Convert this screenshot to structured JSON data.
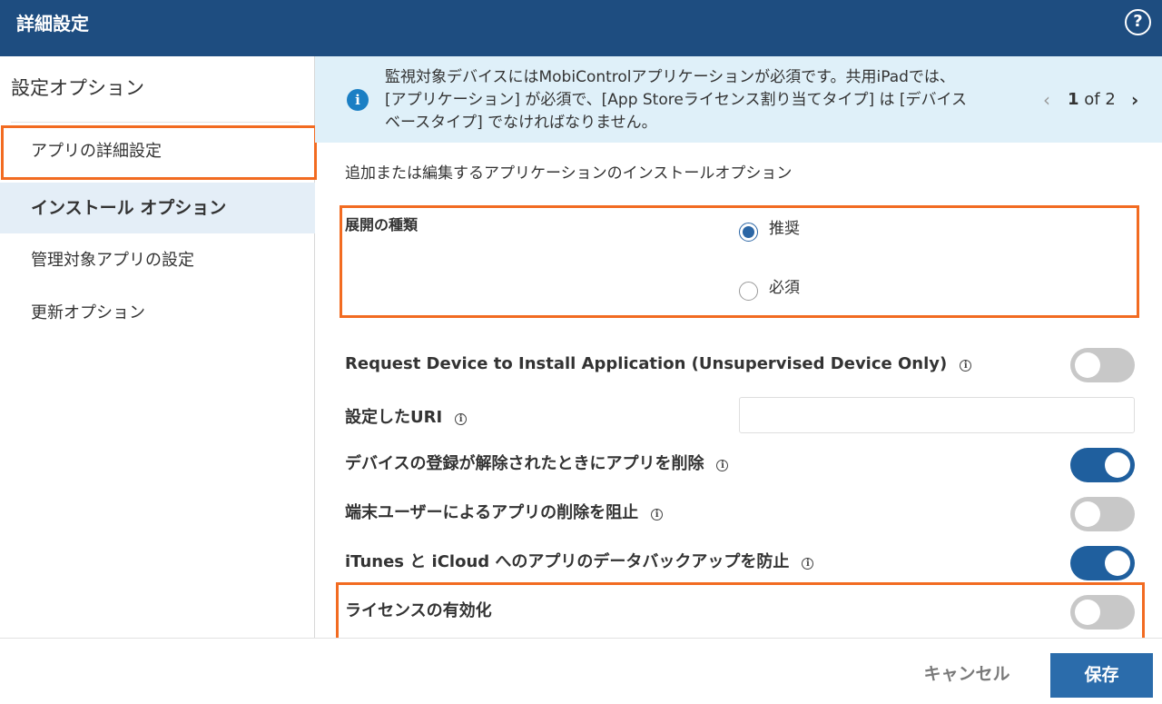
{
  "header": {
    "title": "詳細設定",
    "help_icon": "?"
  },
  "sidebar": {
    "heading": "設定オプション",
    "items": [
      {
        "label": "アプリの詳細設定",
        "active": false
      },
      {
        "label": "インストール オプション",
        "active": true
      },
      {
        "label": "管理対象アプリの設定",
        "active": false
      },
      {
        "label": "更新オプション",
        "active": false
      }
    ]
  },
  "banner": {
    "info_icon": "i",
    "lines": [
      "監視対象デバイスにはMobiControlアプリケーションが必須です。共用iPadでは、",
      "[アプリケーション] が必須で、[App Storeライセンス割り当てタイプ] は [デバイス",
      "ベースタイプ] でなければなりません。"
    ],
    "pager_current": "1",
    "pager_of": "of",
    "pager_total": "2",
    "prev_icon": "‹",
    "next_icon": "›"
  },
  "main": {
    "description": "追加または編集するアプリケーションのインストールオプション",
    "deployment": {
      "label": "展開の種類",
      "options": [
        {
          "label": "推奨",
          "checked": true
        },
        {
          "label": "必須",
          "checked": false
        }
      ]
    },
    "tip_icon": "i",
    "settings": [
      {
        "label": "Request Device to Install Application (Unsupervised Device Only)",
        "type": "toggle",
        "on": false
      },
      {
        "label": "設定したURI",
        "type": "input",
        "value": ""
      },
      {
        "label": "デバイスの登録が解除されたときにアプリを削除",
        "type": "toggle",
        "on": true
      },
      {
        "label": "端末ユーザーによるアプリの削除を阻止",
        "type": "toggle",
        "on": false
      },
      {
        "label": "iTunes と iCloud へのアプリのデータバックアップを防止",
        "type": "toggle",
        "on": true
      },
      {
        "label": "ライセンスの有効化",
        "type": "toggle",
        "on": false
      }
    ]
  },
  "footer": {
    "cancel_label": "キャンセル",
    "save_label": "保存"
  },
  "colors": {
    "header": "#1e4d80",
    "accent": "#2b6cab",
    "highlight": "#f26b21",
    "banner": "#dff0f9"
  }
}
